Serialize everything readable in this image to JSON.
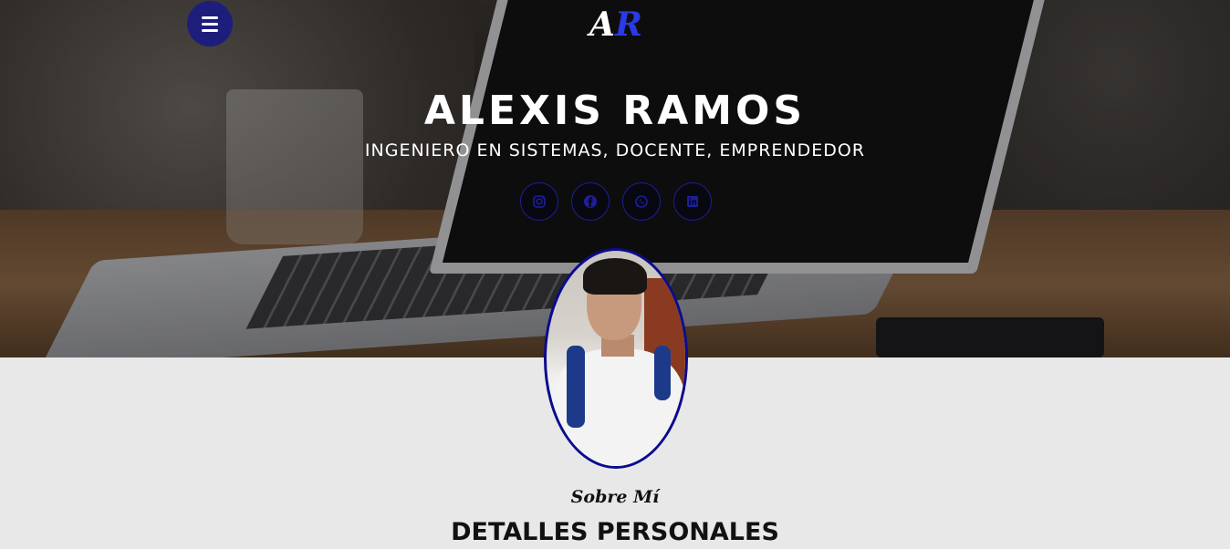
{
  "header": {
    "logo": {
      "letter_a": "A",
      "letter_r": "R",
      "accent_color": "#2a3ae8"
    },
    "menu_icon": "hamburger-icon",
    "name": "ALEXIS RAMOS",
    "tagline": "INGENIERO EN SISTEMAS, DOCENTE, EMPRENDEDOR",
    "socials": [
      {
        "icon": "instagram-icon"
      },
      {
        "icon": "facebook-icon"
      },
      {
        "icon": "whatsapp-icon"
      },
      {
        "icon": "linkedin-icon"
      }
    ]
  },
  "about": {
    "kicker": "Sobre Mí",
    "title": "DETALLES PERSONALES"
  },
  "colors": {
    "primary": "#1d1e7c",
    "avatar_border": "#0b0b8e",
    "section_bg": "#e8e8e8"
  }
}
